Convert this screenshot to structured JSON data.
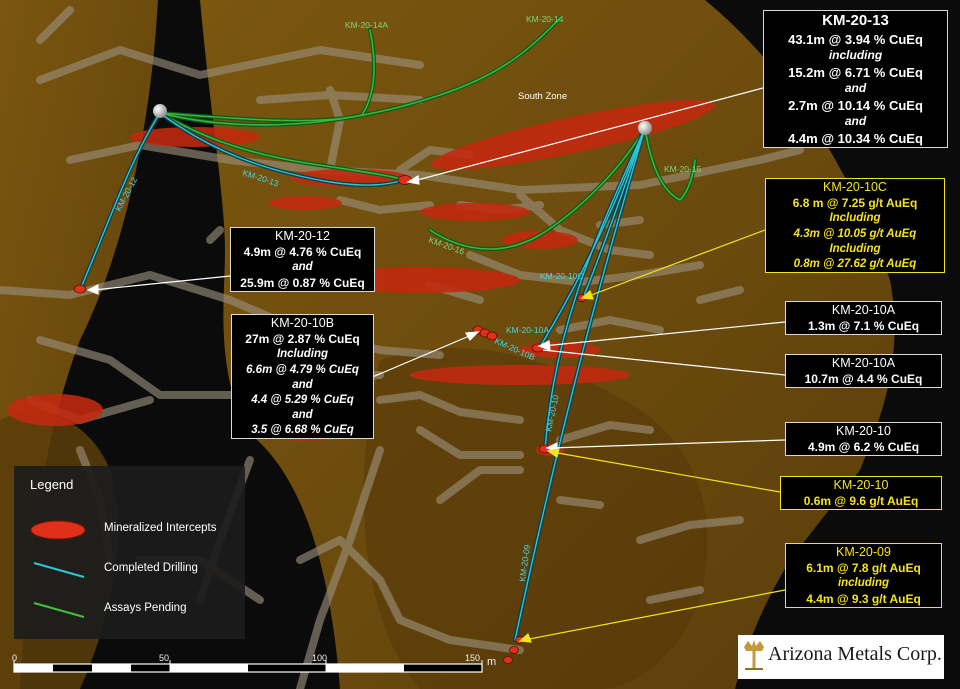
{
  "title": "",
  "colors": {
    "host_rock": "#6b4a0c",
    "intercept": "#d42b12",
    "completed_drilling": "#2cc6d6",
    "assays_pending": "#3fc33f",
    "label_white": "#ffffff",
    "label_yellow": "#f5e31a"
  },
  "zone_label": "South Zone",
  "trace_labels": {
    "km_20_14a": "KM-20-14A",
    "km_20_14": "KM-20-14",
    "km_20_12": "KM-20-12",
    "km_20_13": "KM-20-13",
    "km_20_15": "KM-20-15",
    "km_20_16": "KM-20-16",
    "km_20_10c": "KM-20-10C",
    "km_20_10a": "KM-20-10A",
    "km_20_10b": "KM-20-10B",
    "km_20_10": "KM-20-10",
    "km_20_09": "KM-20-09"
  },
  "callouts": {
    "km_20_13": {
      "title": "KM-20-13",
      "lines": [
        {
          "text": "43.1m @ 3.94 % CuEq",
          "kind": "value"
        },
        {
          "text": "including",
          "kind": "conj"
        },
        {
          "text": "15.2m @ 6.71 % CuEq",
          "kind": "value"
        },
        {
          "text": "and",
          "kind": "conj"
        },
        {
          "text": "2.7m @ 10.14 % CuEq",
          "kind": "value"
        },
        {
          "text": "and",
          "kind": "conj"
        },
        {
          "text": "4.4m @ 10.34 % CuEq",
          "kind": "value"
        }
      ]
    },
    "km_20_12": {
      "title": "KM-20-12",
      "lines": [
        {
          "text": "4.9m @ 4.76 % CuEq",
          "kind": "value"
        },
        {
          "text": "and",
          "kind": "conj"
        },
        {
          "text": "25.9m @ 0.87 % CuEq",
          "kind": "value"
        }
      ]
    },
    "km_20_10b": {
      "title": "KM-20-10B",
      "lines": [
        {
          "text": "27m @ 2.87 % CuEq",
          "kind": "value"
        },
        {
          "text": "Including",
          "kind": "conj"
        },
        {
          "text": "6.6m @ 4.79 % CuEq",
          "kind": "conj"
        },
        {
          "text": "and",
          "kind": "conj"
        },
        {
          "text": "4.4 @ 5.29 % CuEq",
          "kind": "conj"
        },
        {
          "text": "and",
          "kind": "conj"
        },
        {
          "text": "3.5 @ 6.68 % CuEq",
          "kind": "conj"
        }
      ]
    },
    "km_20_10c": {
      "title": "KM-20-10C",
      "lines": [
        {
          "text": "6.8 m @ 7.25 g/t AuEq",
          "kind": "value"
        },
        {
          "text": "Including",
          "kind": "conj"
        },
        {
          "text": "4.3m @ 10.05 g/t AuEq",
          "kind": "conj"
        },
        {
          "text": "Including",
          "kind": "conj"
        },
        {
          "text": "0.8m @ 27.62 g/t AuEq",
          "kind": "conj"
        }
      ]
    },
    "km_20_10a_1": {
      "title": "KM-20-10A",
      "lines": [
        {
          "text": "1.3m @ 7.1 % CuEq",
          "kind": "value"
        }
      ]
    },
    "km_20_10a_2": {
      "title": "KM-20-10A",
      "lines": [
        {
          "text": "10.7m @ 4.4 % CuEq",
          "kind": "value"
        }
      ]
    },
    "km_20_10_cu": {
      "title": "KM-20-10",
      "lines": [
        {
          "text": "4.9m @ 6.2 % CuEq",
          "kind": "value"
        }
      ]
    },
    "km_20_10_au": {
      "title": "KM-20-10",
      "lines": [
        {
          "text": "0.6m @ 9.6 g/t AuEq",
          "kind": "value"
        }
      ]
    },
    "km_20_09": {
      "title": "KM-20-09",
      "lines": [
        {
          "text": "6.1m @ 7.8 g/t AuEq",
          "kind": "value"
        },
        {
          "text": "including",
          "kind": "conj"
        },
        {
          "text": "4.4m @ 9.3 g/t AuEq",
          "kind": "value"
        }
      ]
    }
  },
  "legend": {
    "title": "Legend",
    "items": [
      {
        "label": "Mineralized Intercepts",
        "symbol": "intercept"
      },
      {
        "label": "Completed Drilling",
        "symbol": "completed"
      },
      {
        "label": "Assays Pending",
        "symbol": "pending"
      }
    ]
  },
  "scale_bar": {
    "ticks": [
      "0",
      "50",
      "100",
      "150"
    ],
    "unit": "m"
  },
  "logo": {
    "name": "Arizona Metals Corp.",
    "icon": "mining-pick-emblem-icon"
  }
}
